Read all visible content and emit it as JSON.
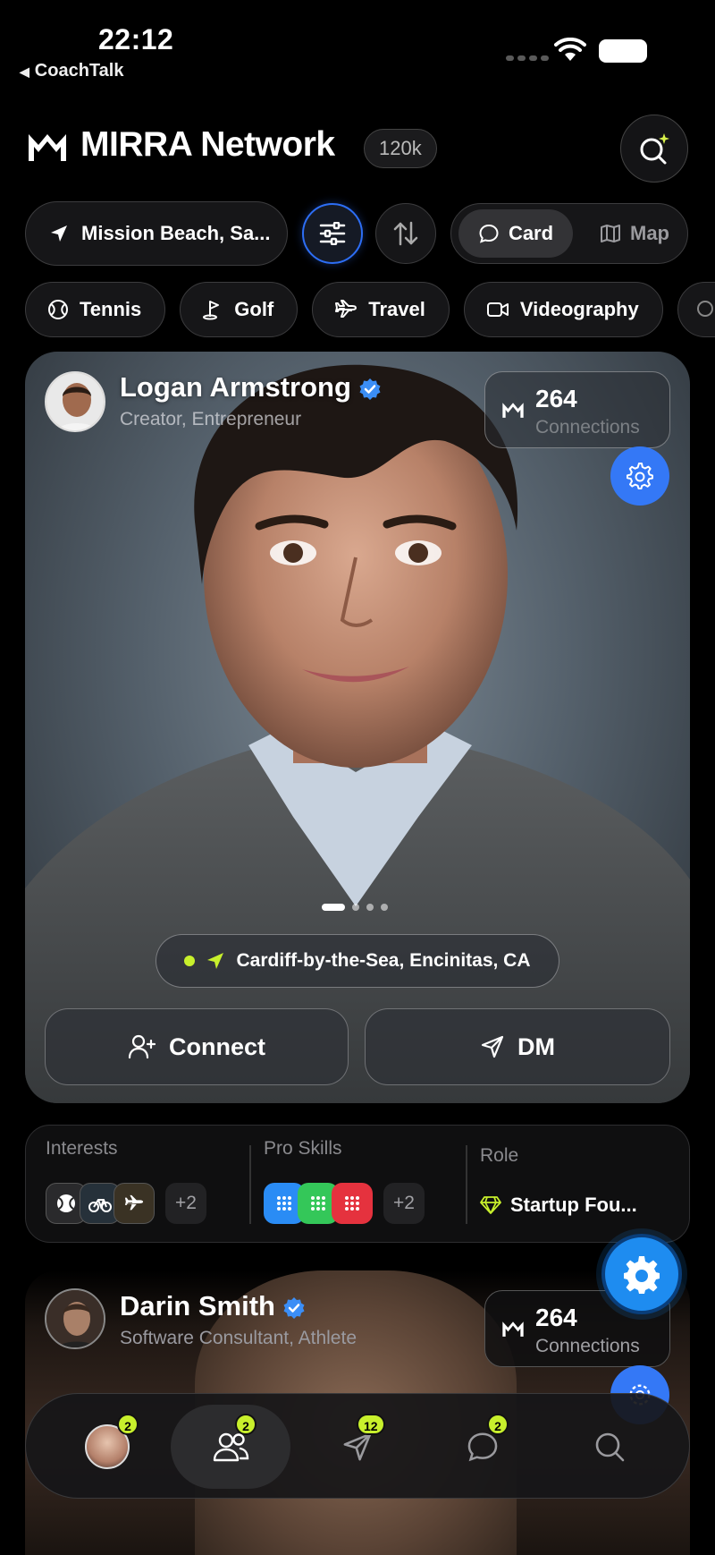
{
  "status_bar": {
    "time": "22:12",
    "back_app": "CoachTalk"
  },
  "header": {
    "brand": "MIRRA Network",
    "count": "120k"
  },
  "toolbar": {
    "location": "Mission Beach, Sa...",
    "view_card": "Card",
    "view_map": "Map"
  },
  "chips": [
    {
      "label": "Tennis",
      "icon": "tennis-ball-icon"
    },
    {
      "label": "Golf",
      "icon": "golf-flag-icon"
    },
    {
      "label": "Travel",
      "icon": "airplane-icon"
    },
    {
      "label": "Videography",
      "icon": "video-camera-icon"
    }
  ],
  "profile1": {
    "name": "Logan Armstrong",
    "subtitle": "Creator, Entrepreneur",
    "connections_count": "264",
    "connections_label": "Connections",
    "photo_page": 1,
    "photo_pages": 4,
    "location": "Cardiff-by-the-Sea, Encinitas, CA",
    "connect_label": "Connect",
    "dm_label": "DM"
  },
  "info": {
    "interests_label": "Interests",
    "interests_more": "+2",
    "skills_label": "Pro Skills",
    "skills_more": "+2",
    "role_label": "Role",
    "role_value": "Startup Fou..."
  },
  "profile2": {
    "name": "Darin Smith",
    "subtitle": "Software Consultant, Athlete",
    "connections_count": "264",
    "connections_label": "Connections"
  },
  "tabbar": {
    "badges": {
      "profile": "2",
      "people": "2",
      "send": "12",
      "chat": "2"
    }
  },
  "colors": {
    "accent_blue": "#3478f6",
    "lime": "#c8f02c",
    "background": "#000000"
  }
}
